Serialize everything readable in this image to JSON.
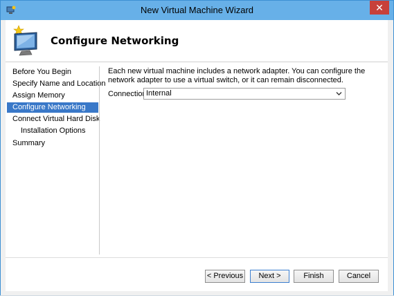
{
  "window": {
    "title": "New Virtual Machine Wizard",
    "close_label": "✕"
  },
  "header": {
    "title": "Configure Networking"
  },
  "nav": {
    "items": [
      {
        "label": "Before You Begin"
      },
      {
        "label": "Specify Name and Location"
      },
      {
        "label": "Assign Memory"
      },
      {
        "label": "Configure Networking"
      },
      {
        "label": "Connect Virtual Hard Disk"
      },
      {
        "label": "Installation Options"
      },
      {
        "label": "Summary"
      }
    ],
    "selected_index": 3
  },
  "main": {
    "description": "Each new virtual machine includes a network adapter. You can configure the network adapter to use a virtual switch, or it can remain disconnected.",
    "connection_label": "Connection:",
    "connection_value": "Internal"
  },
  "buttons": {
    "previous": "< Previous",
    "next": "Next >",
    "finish": "Finish",
    "cancel": "Cancel"
  },
  "colors": {
    "titlebar": "#67b0e8",
    "selection": "#3978c8",
    "close": "#c7403a"
  }
}
